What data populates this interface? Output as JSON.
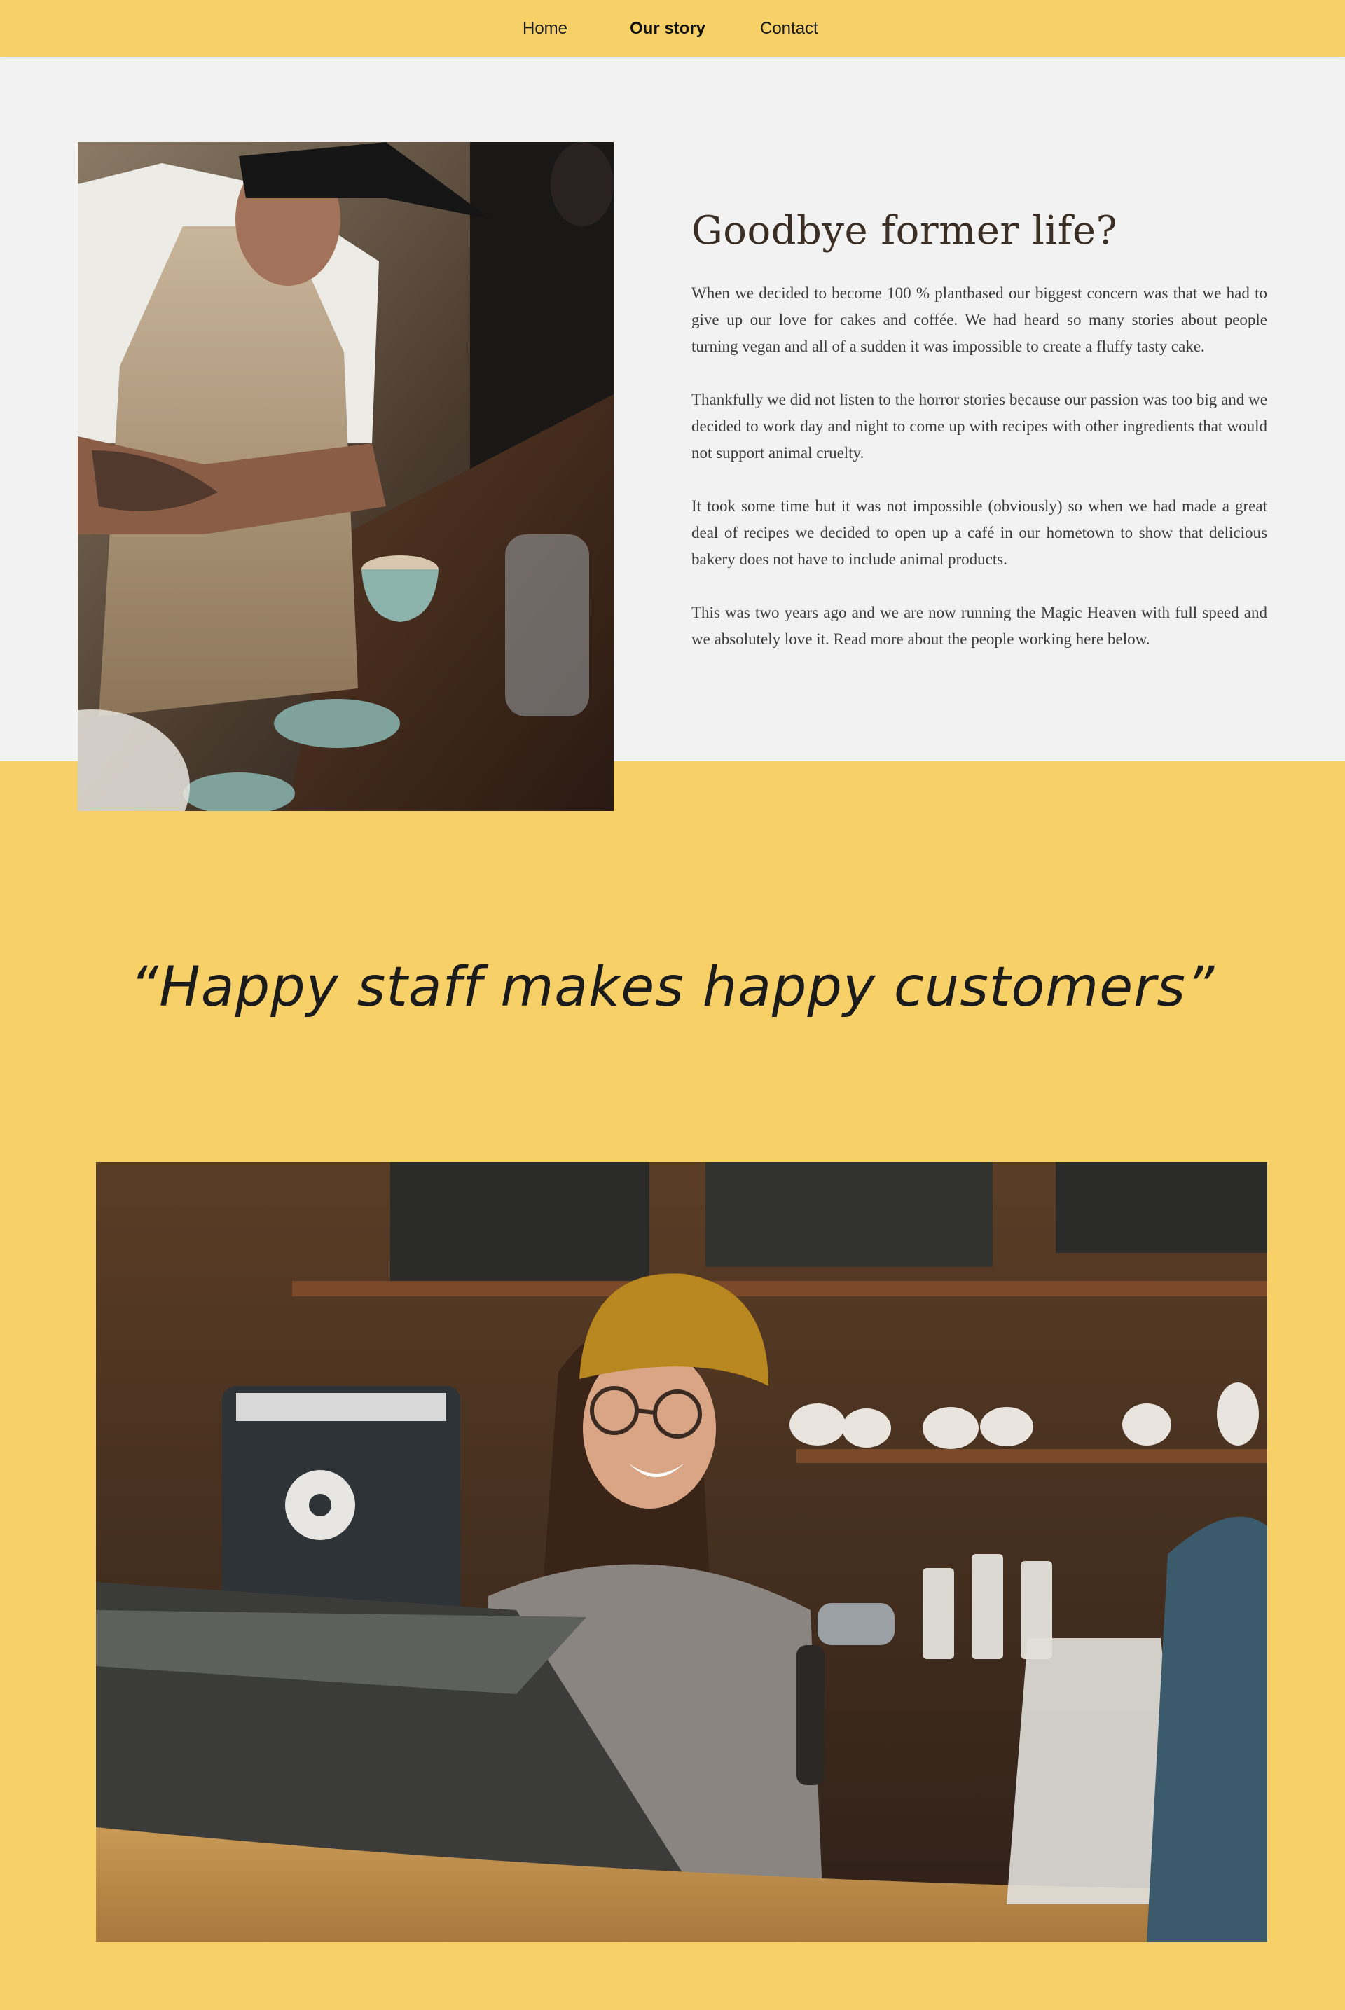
{
  "nav": {
    "links": [
      {
        "label": "Home",
        "active": false
      },
      {
        "label": "Our story",
        "active": true
      },
      {
        "label": "Contact",
        "active": false
      }
    ]
  },
  "story": {
    "heading": "Goodbye former life?",
    "paragraphs": [
      "When we decided to become 100 % plantbased our biggest concern was that we had to give up our love for cakes and coffée. We had heard so many stories about people turning vegan and all of a sudden it was impossible to create a fluffy tasty cake.",
      "Thankfully we did not listen to the horror stories because our passion was too big and we decided to work day and night to come up with recipes with other ingredients that would not support animal cruelty.",
      "It took some time but it was not impossible (obviously) so when we had made a great deal of recipes we decided to open up a café in our hometown to show that delicious bakery does not have to include animal products.",
      "This was two years ago and we are now running the Magic Heaven with full speed and we absolutely love it. Read more about the people working here below."
    ]
  },
  "quote": {
    "text": "“Happy staff makes happy customers”"
  },
  "colors": {
    "brand_yellow": "#f7d068",
    "section_gray": "#f2f2f2",
    "heading_brown": "#3a2e25"
  }
}
